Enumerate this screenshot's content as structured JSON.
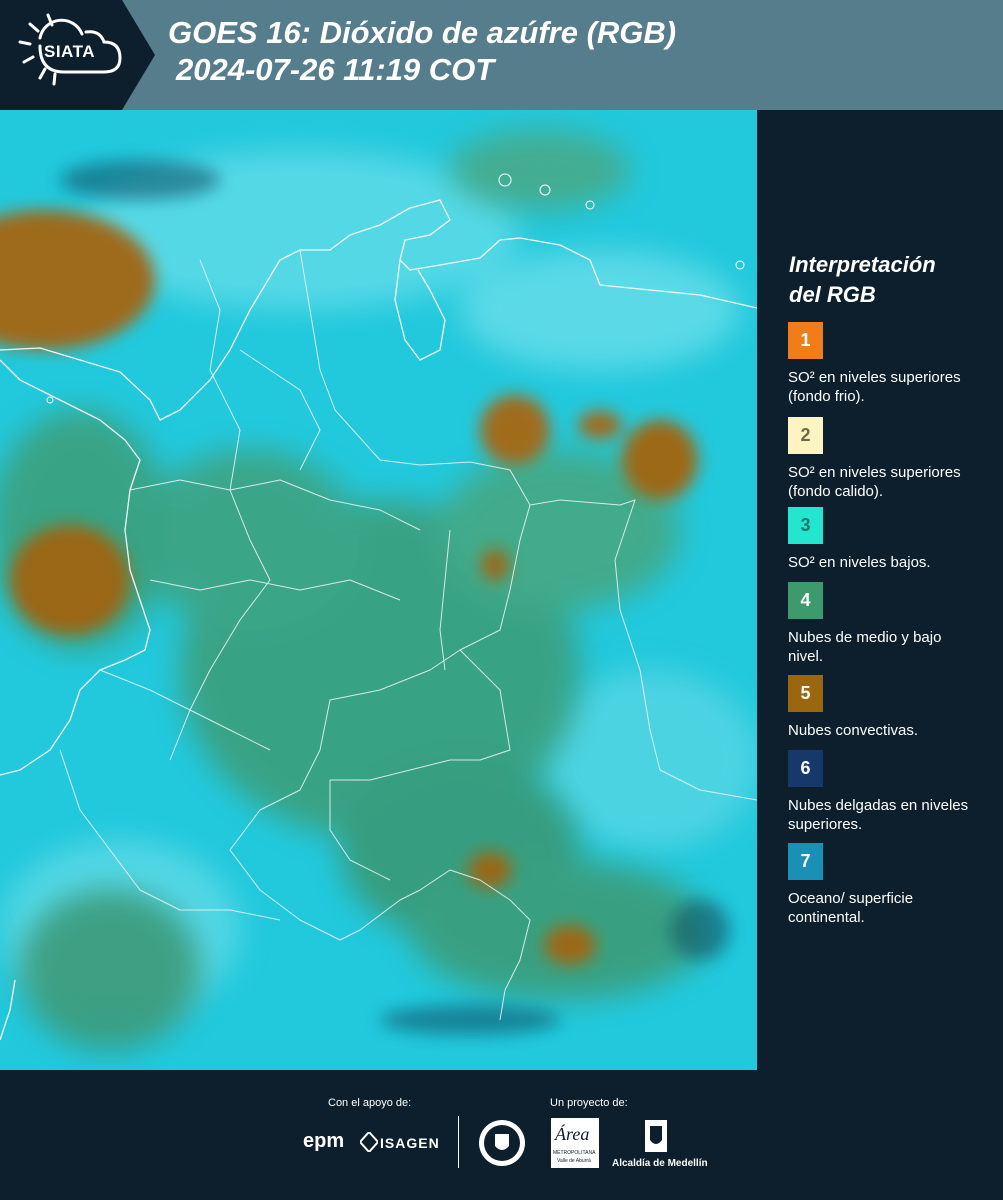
{
  "header": {
    "logo_label": "SIATA",
    "title_line1": "GOES 16: Dióxido de azúfre (RGB)",
    "title_line2": "2024-07-26 11:19 COT"
  },
  "legend": {
    "title_line1": "Interpretación",
    "title_line2": "del RGB",
    "items": [
      {
        "num": "1",
        "color": "#f07c1a",
        "text_color": "#ffffff",
        "label": "SO² en niveles superiores (fondo frio)."
      },
      {
        "num": "2",
        "color": "#fdf4c4",
        "text_color": "#6b6b4a",
        "label": "SO² en niveles superiores (fondo calido)."
      },
      {
        "num": "3",
        "color": "#24e6cf",
        "text_color": "#167a6e",
        "label": "SO² en niveles bajos."
      },
      {
        "num": "4",
        "color": "#3d9a6d",
        "text_color": "#ffffff",
        "label": "Nubes de medio y bajo nivel."
      },
      {
        "num": "5",
        "color": "#9b6610",
        "text_color": "#ffffff",
        "label": "Nubes convectivas."
      },
      {
        "num": "6",
        "color": "#17386a",
        "text_color": "#ffffff",
        "label": "Nubes delgadas en niveles superiores."
      },
      {
        "num": "7",
        "color": "#1a8fb8",
        "text_color": "#ffffff",
        "label": "Oceano/ superficie continental."
      }
    ]
  },
  "footer": {
    "support_label": "Con el apoyo de:",
    "project_label": "Un proyecto de:",
    "epm": "epm",
    "isagen": "ISAGEN",
    "area": "Área",
    "area_sub1": "METROPOLITANA",
    "area_sub2": "Valle de Aburrá",
    "alcaldia": "Alcaldía de Medellín"
  },
  "colors": {
    "header_bg": "#567d8c",
    "panel_bg": "#0d1f2d",
    "map_cyan": "#1fc6d8",
    "cloud_green": "#3f9a6a",
    "cloud_brown": "#9b6a18"
  }
}
